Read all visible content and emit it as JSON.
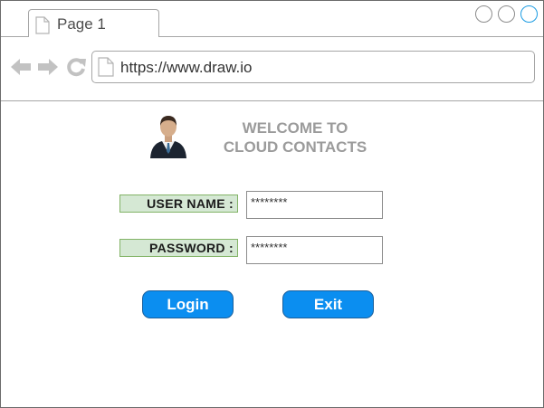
{
  "browser": {
    "tab_label": "Page 1",
    "url": "https://www.draw.io",
    "icons": [
      "page-icon",
      "back-arrow-icon",
      "forward-arrow-icon",
      "reload-icon"
    ],
    "accent_color": "#1a9be2"
  },
  "login": {
    "welcome_line1": "WELCOME TO",
    "welcome_line2": "CLOUD CONTACTS",
    "username_label": "USER NAME :",
    "username_value": "********",
    "password_label": "PASSWORD :",
    "password_value": "********",
    "login_button": "Login",
    "exit_button": "Exit",
    "label_bg_color": "#d5e8d4",
    "button_color": "#0b8ef0"
  }
}
